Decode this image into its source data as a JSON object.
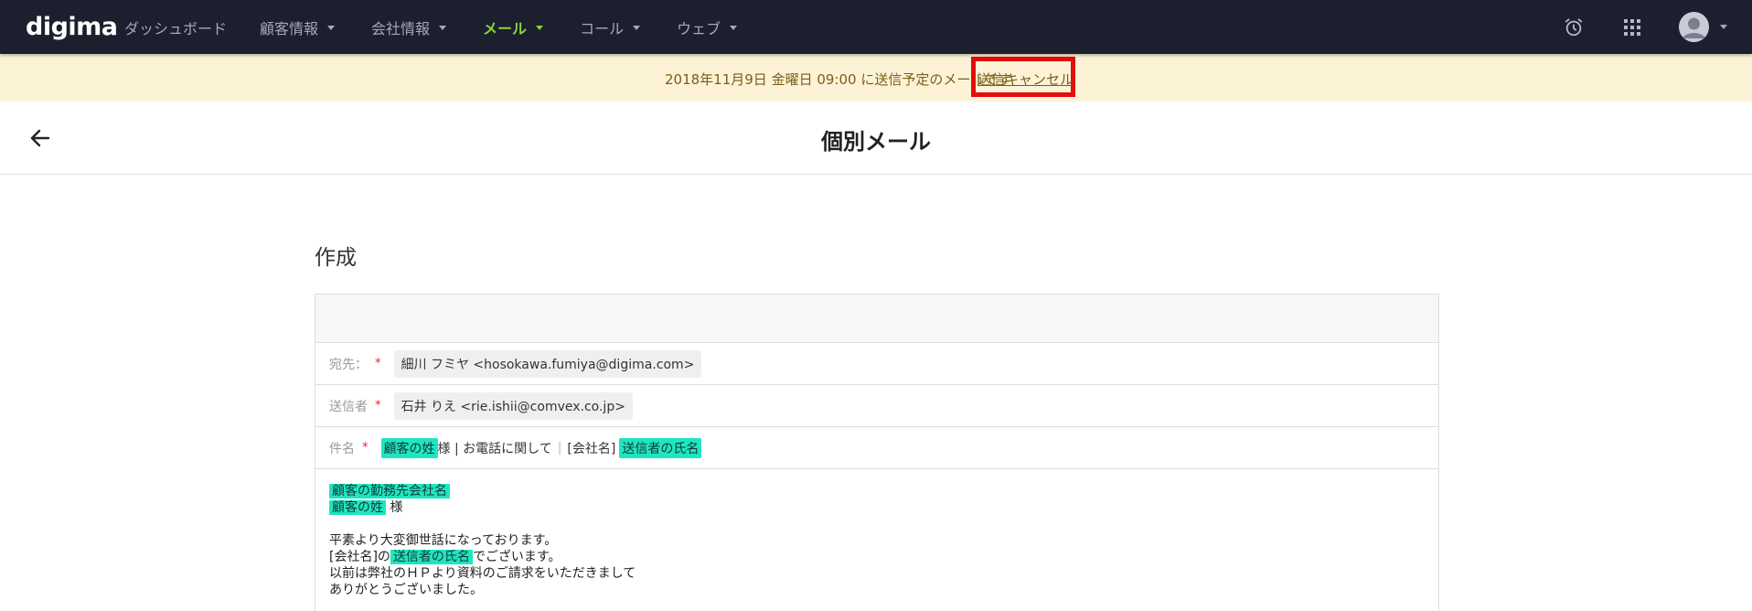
{
  "brand": {
    "logo_text": "digima",
    "accent": "#7ccf3a"
  },
  "nav": {
    "items": [
      {
        "label": "ダッシュボード",
        "dropdown": false,
        "active": false
      },
      {
        "label": "顧客情報",
        "dropdown": true,
        "active": false
      },
      {
        "label": "会社情報",
        "dropdown": true,
        "active": false
      },
      {
        "label": "メール",
        "dropdown": true,
        "active": true
      },
      {
        "label": "コール",
        "dropdown": true,
        "active": false
      },
      {
        "label": "ウェブ",
        "dropdown": true,
        "active": false
      }
    ],
    "right_icons": [
      "alarm-clock-icon",
      "apps-grid-icon",
      "user-avatar-icon"
    ]
  },
  "notice": {
    "message": "2018年11月9日 金曜日 09:00 に送信予定のメールです",
    "cancel_label": "送信キャンセル"
  },
  "page": {
    "title": "個別メール",
    "back_icon": "arrow-left-icon"
  },
  "section": {
    "title": "作成"
  },
  "form": {
    "to": {
      "label": "宛先：",
      "value": "細川 フミヤ <hosokawa.fumiya@digima.com>"
    },
    "from": {
      "label": "送信者",
      "value": "石井 りえ <rie.ishii@comvex.co.jp>"
    },
    "subject": {
      "label": "件名",
      "tag1": "顧客の姓",
      "text1": "様 | お電話に関して",
      "sep": "|",
      "text2": "[会社名]",
      "tag2": "送信者の氏名"
    },
    "body": {
      "line1_tag": "顧客の勤務先会社名",
      "line2_tag": "顧客の姓",
      "line2_text": "様",
      "line4": "平素より大変御世話になっております。",
      "line5_pre": "[会社名]の",
      "line5_tag": "送信者の氏名",
      "line5_post": "でございます。",
      "line6": "以前は弊社のＨＰより資料のご請求をいただきまして",
      "line7": "ありがとうございました。"
    },
    "required_mark": "*"
  }
}
